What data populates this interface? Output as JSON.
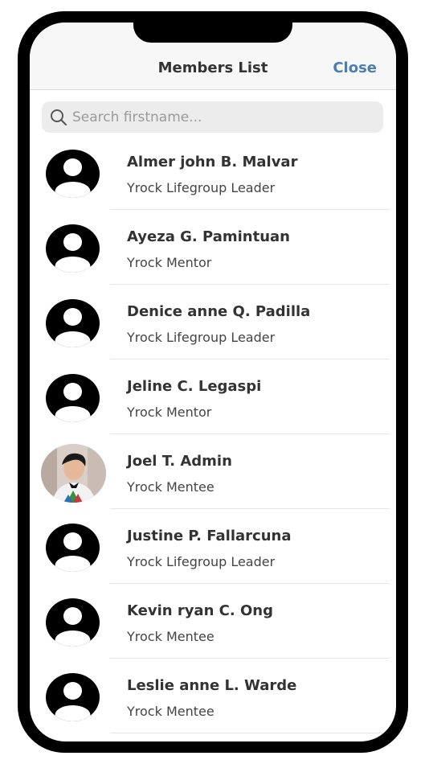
{
  "header": {
    "title": "Members List",
    "close_label": "Close"
  },
  "search": {
    "placeholder": "Search firstname...",
    "value": ""
  },
  "members": [
    {
      "name": "Almer john B. Malvar",
      "role": "Yrock Lifegroup Leader",
      "avatar": "default-avatar-icon"
    },
    {
      "name": "Ayeza G. Pamintuan",
      "role": "Yrock Mentor",
      "avatar": "default-avatar-icon"
    },
    {
      "name": "Denice anne Q. Padilla",
      "role": "Yrock Lifegroup Leader",
      "avatar": "default-avatar-icon"
    },
    {
      "name": "Jeline C. Legaspi",
      "role": "Yrock Mentor",
      "avatar": "default-avatar-icon"
    },
    {
      "name": "Joel T. Admin",
      "role": "Yrock Mentee",
      "avatar": "profile-photo"
    },
    {
      "name": "Justine P. Fallarcuna",
      "role": "Yrock Lifegroup Leader",
      "avatar": "default-avatar-icon"
    },
    {
      "name": "Kevin ryan C. Ong",
      "role": "Yrock Mentee",
      "avatar": "default-avatar-icon"
    },
    {
      "name": "Leslie anne L. Warde",
      "role": "Yrock Mentee",
      "avatar": "default-avatar-icon"
    }
  ],
  "colors": {
    "accent": "#4a7fb0",
    "text": "#333333",
    "frame": "#000000",
    "search_bg": "#ececec"
  }
}
